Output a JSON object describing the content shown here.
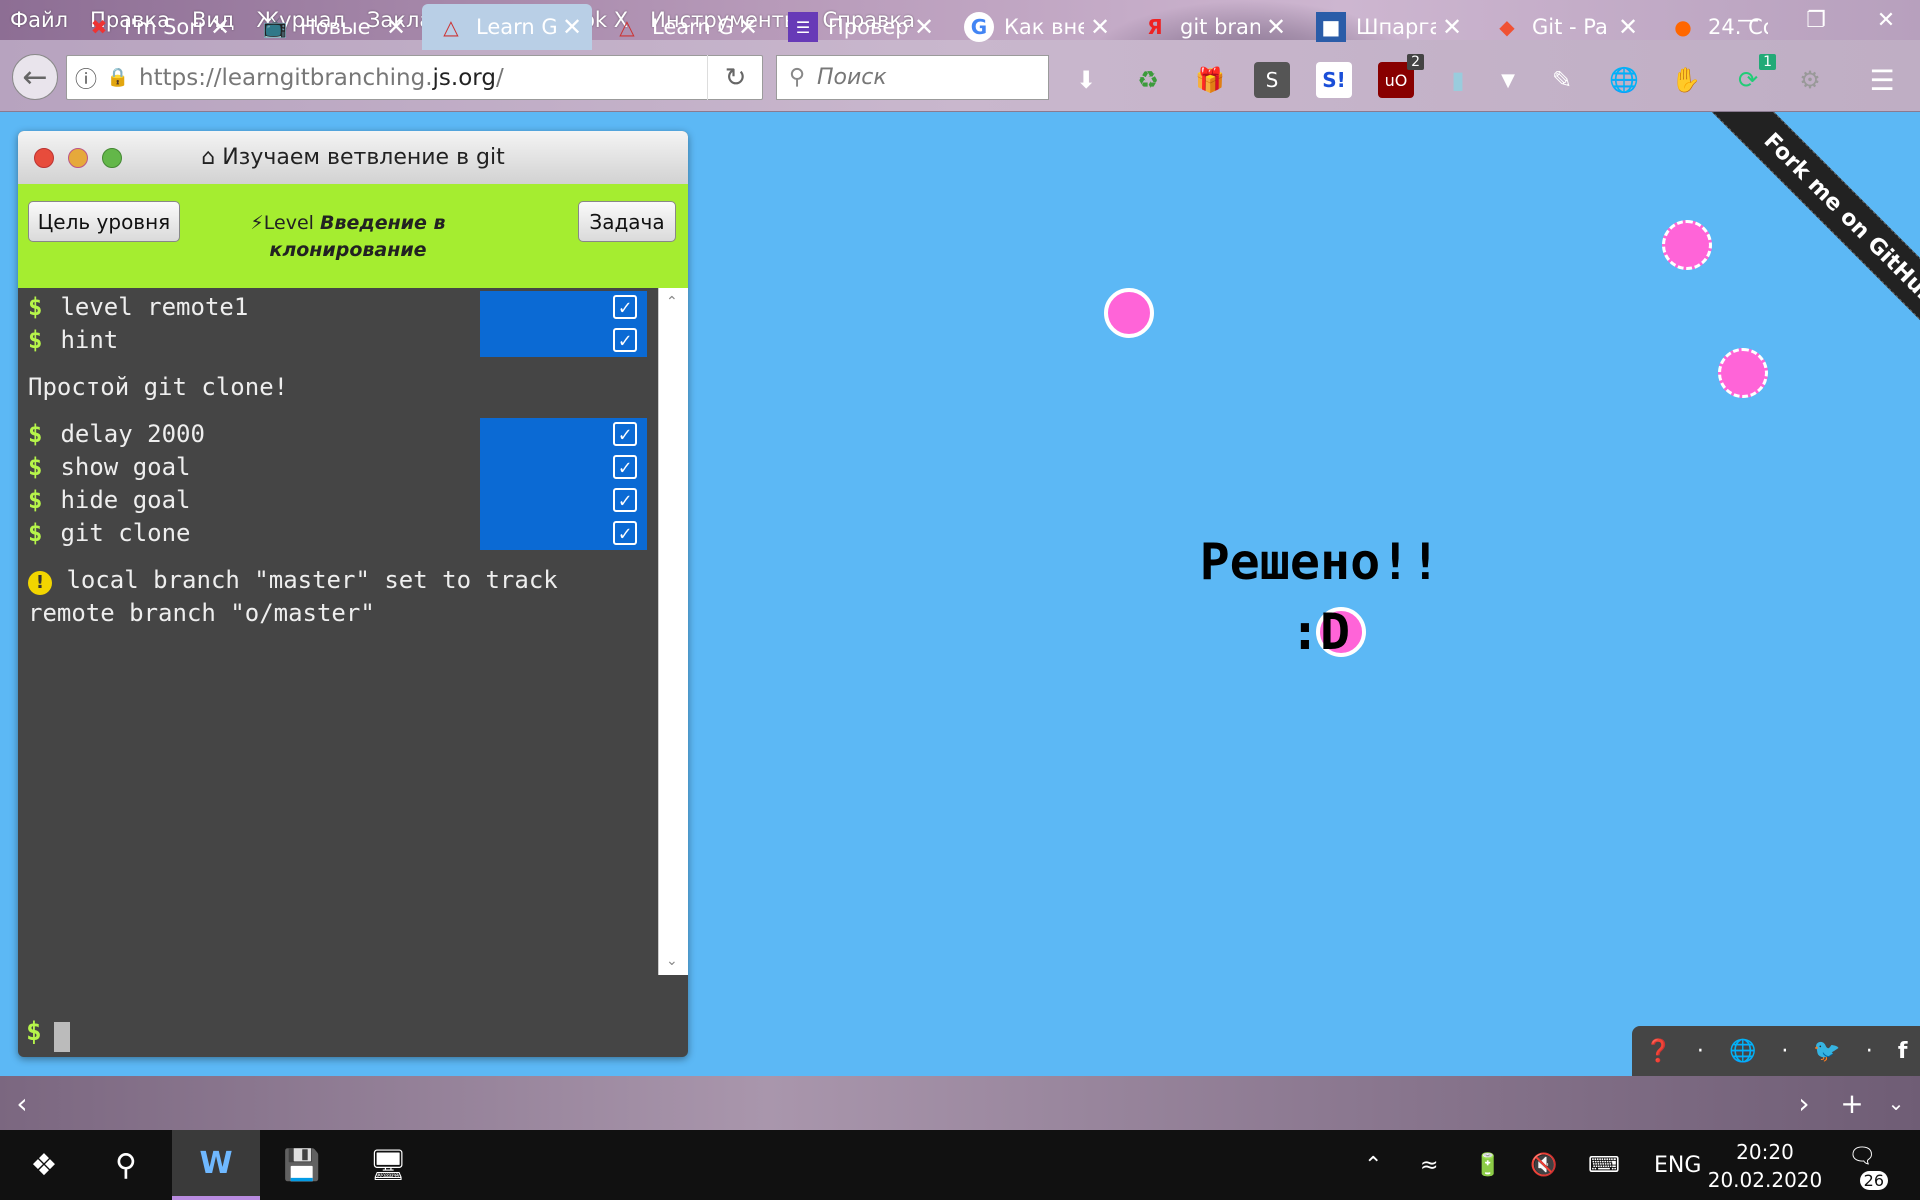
{
  "menubar": {
    "items": [
      "Файл",
      "Правка",
      "Вид",
      "Журнал",
      "Закладки",
      "ScrapBook X",
      "Инструменты",
      "Справка"
    ]
  },
  "navbar": {
    "url_prefix": "https://learngitbranching.",
    "url_domain": "js.org",
    "url_suffix": "/",
    "search_placeholder": "Поиск",
    "badge_ublock": "2",
    "badge_sync": "1"
  },
  "terminal": {
    "title": "Изучаем ветвление в git",
    "goal_button": "Цель уровня",
    "task_button": "Задача",
    "level_prefix": "Level",
    "level_name": "Введение в клонирование",
    "commands": [
      {
        "text": "level remote1",
        "done": true
      },
      {
        "text": "hint",
        "done": true
      }
    ],
    "message1": "Простой git clone!",
    "commands2": [
      {
        "text": "delay 2000",
        "done": true
      },
      {
        "text": "show goal",
        "done": true
      },
      {
        "text": "hide goal",
        "done": true
      },
      {
        "text": "git clone",
        "done": true
      }
    ],
    "warning": "local branch \"master\" set to track remote branch \"o/master\"",
    "prompt": "$"
  },
  "canvas": {
    "solved_line1": "Решено!!",
    "solved_line2": ":D"
  },
  "ribbon": "Fork me on GitHub",
  "tabs": [
    {
      "label": "I'm Sorry",
      "icon": "x"
    },
    {
      "label": "Новые",
      "icon": "tv"
    },
    {
      "label": "Learn Git",
      "icon": "git"
    },
    {
      "label": "Learn Git",
      "icon": "git"
    },
    {
      "label": "Провер",
      "icon": "form"
    },
    {
      "label": "Как вне",
      "icon": "G"
    },
    {
      "label": "git bran",
      "icon": "Я"
    },
    {
      "label": "Шпарга",
      "icon": "img"
    },
    {
      "label": "Git - Pa",
      "icon": "git"
    },
    {
      "label": "24. Co",
      "icon": "ic"
    }
  ],
  "taskbar": {
    "lang": "ENG",
    "time": "20:20",
    "date": "20.02.2020",
    "notifications": "26"
  }
}
